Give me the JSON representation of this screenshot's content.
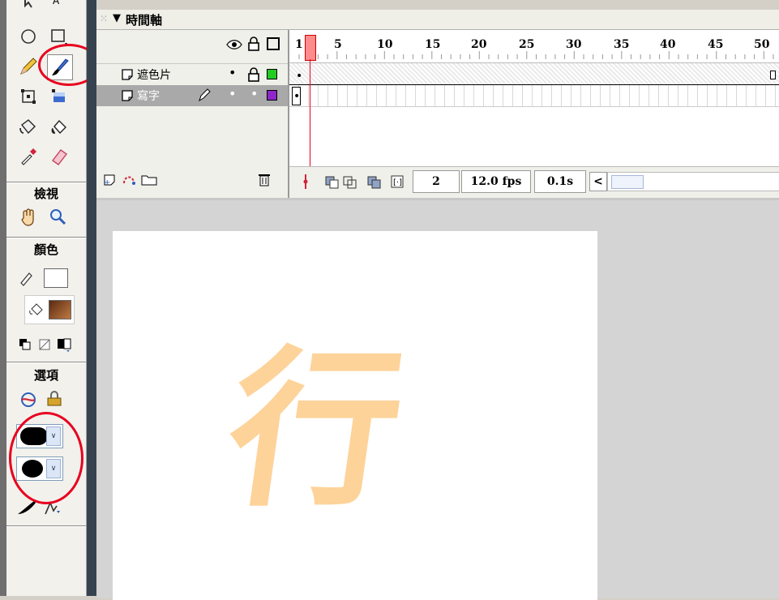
{
  "timeline": {
    "panel_title": "時間軸",
    "ruler_numbers": [
      "1",
      "5",
      "10",
      "15",
      "20",
      "25",
      "30",
      "35",
      "40",
      "45",
      "50"
    ],
    "layers": [
      {
        "name": "遮色片",
        "selected": false,
        "color": "#22cc22"
      },
      {
        "name": "寫字",
        "selected": true,
        "color": "#8e26c9"
      }
    ],
    "status": {
      "current_frame": "2",
      "frame_rate": "12.0 fps",
      "elapsed_time": "0.1s"
    }
  },
  "tools": {
    "view_label": "檢視",
    "color_label": "顏色",
    "options_label": "選項"
  },
  "stage": {
    "glyph": "行",
    "glyph_color": "#fdd39a"
  },
  "colors": {
    "highlight": "#e8001e",
    "fill_swatch": "#8b4a22"
  }
}
